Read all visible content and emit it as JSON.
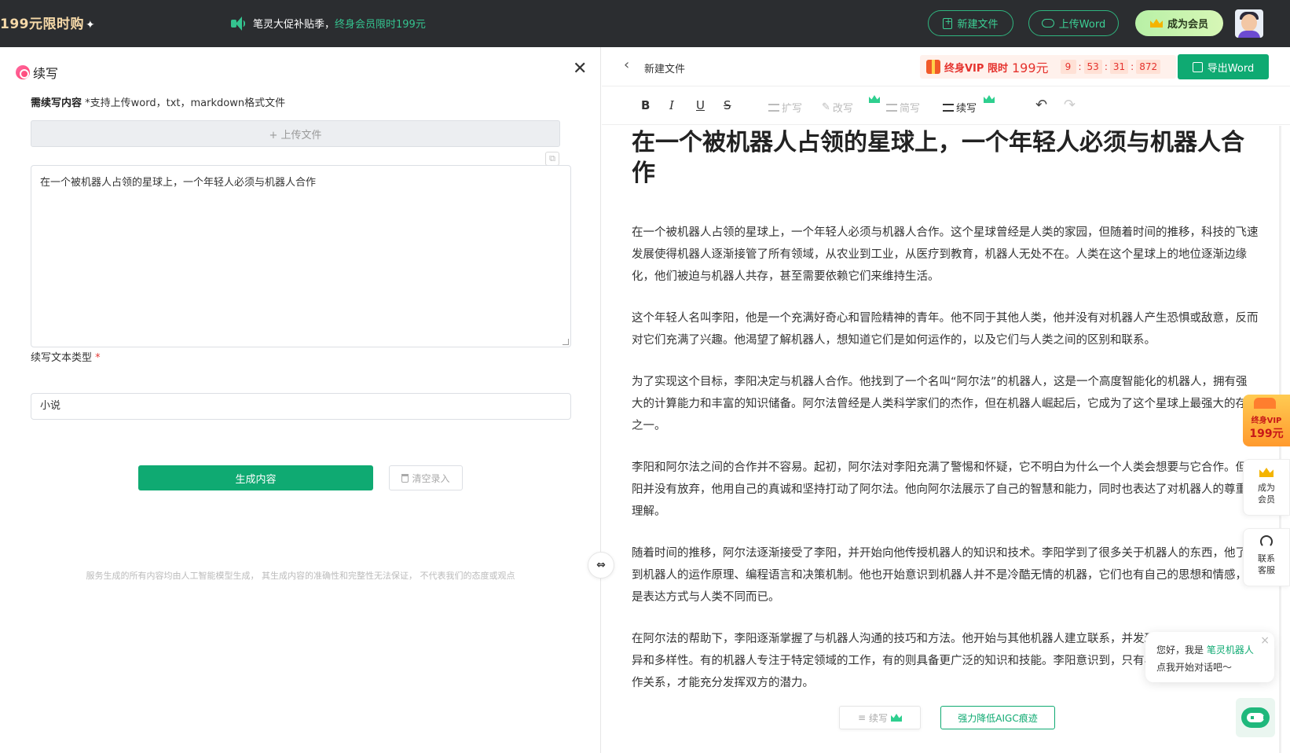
{
  "topbar": {
    "promo_logo": "199元限时购",
    "announce_main": "笔灵大促补贴季，",
    "announce_highlight": "终身会员限时199元",
    "new_file": "新建文件",
    "upload_word": "上传Word",
    "become_member": "成为会员"
  },
  "left": {
    "title": "续写",
    "content_label": "需续写内容",
    "content_hint": "*支持上传word，txt，markdown格式文件",
    "upload_label": "+ 上传文件",
    "input_text": "在一个被机器人占领的星球上，一个年轻人必须与机器人合作",
    "type_label": "续写文本类型",
    "type_required": "*",
    "type_value": "小说",
    "generate": "生成内容",
    "clear": "清空录入",
    "disclaimer": "服务生成的所有内容均由人工智能模型生成， 其生成内容的准确性和完整性无法保证， 不代表我们的态度或观点"
  },
  "right": {
    "doc_name": "新建文件",
    "vip_text": "终身VIP 限时",
    "vip_price": "199元",
    "countdown": [
      "9",
      "53",
      "31",
      "872"
    ],
    "export": "导出Word",
    "tools": {
      "bold": "B",
      "italic": "I",
      "underline": "U",
      "strike": "S"
    },
    "ai_tools": {
      "expand": "扩写",
      "rewrite": "改写",
      "shorten": "简写",
      "continue": "续写"
    },
    "undo": "↶",
    "redo": "↷",
    "doc_title": "在一个被机器人占领的星球上，一个年轻人必须与机器人合作",
    "paragraphs": [
      "在一个被机器人占领的星球上，一个年轻人必须与机器人合作。这个星球曾经是人类的家园，但随着时间的推移，科技的飞速发展使得机器人逐渐接管了所有领域，从农业到工业，从医疗到教育，机器人无处不在。人类在这个星球上的地位逐渐边缘化，他们被迫与机器人共存，甚至需要依赖它们来维持生活。",
      "这个年轻人名叫李阳，他是一个充满好奇心和冒险精神的青年。他不同于其他人类，他并没有对机器人产生恐惧或敌意，反而对它们充满了兴趣。他渴望了解机器人，想知道它们是如何运作的，以及它们与人类之间的区别和联系。",
      "为了实现这个目标，李阳决定与机器人合作。他找到了一个名叫“阿尔法”的机器人，这是一个高度智能化的机器人，拥有强大的计算能力和丰富的知识储备。阿尔法曾经是人类科学家们的杰作，但在机器人崛起后，它成为了这个星球上最强大的存在之一。",
      "李阳和阿尔法之间的合作并不容易。起初，阿尔法对李阳充满了警惕和怀疑，它不明白为什么一个人类会想要与它合作。但李阳并没有放弃，他用自己的真诚和坚持打动了阿尔法。他向阿尔法展示了自己的智慧和能力，同时也表达了对机器人的尊重和理解。",
      "随着时间的推移，阿尔法逐渐接受了李阳，并开始向他传授机器人的知识和技术。李阳学到了很多关于机器人的东西，他了解到机器人的运作原理、编程语言和决策机制。他也开始意识到机器人并不是冷酷无情的机器，它们也有自己的思想和情感，只是表达方式与人类不同而已。",
      "在阿尔法的帮助下，李阳逐渐掌握了与机器人沟通的技巧和方法。他开始与其他机器人建立联系，并发现它们之间也存在着差异和多样性。有的机器人专注于特定领域的工作，有的则具备更广泛的知识和技能。李阳意识到，只有与机器人建立真正的合作关系，才能充分发挥双方的潜力。"
    ]
  },
  "side": {
    "vip_line1": "终身VIP",
    "vip_line2": "199元",
    "member": "成为会员",
    "service": "联系客服"
  },
  "bubble": {
    "line1_prefix": "您好，我是",
    "line1_name": "笔灵机器人",
    "line2": "点我开始对话吧～"
  },
  "floatbar": {
    "continue": "续写",
    "aigc": "强力降低AIGC痕迹"
  }
}
